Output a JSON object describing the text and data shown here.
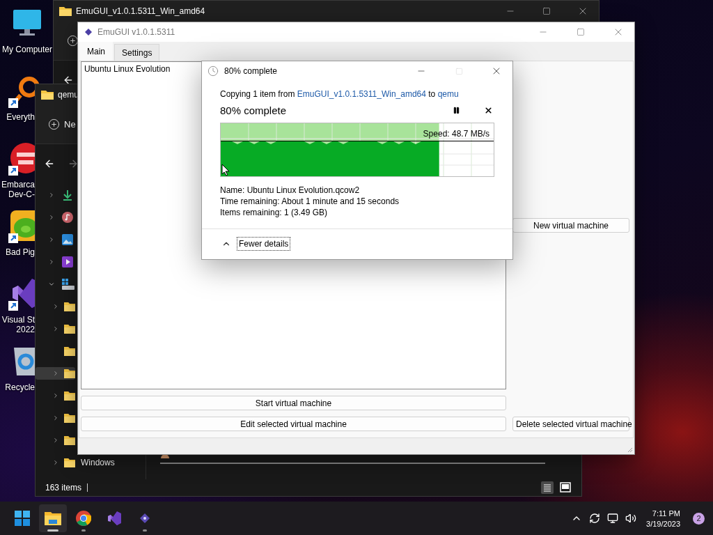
{
  "desktop_icons": [
    {
      "kind": "computer",
      "lines": [
        "My Computer"
      ],
      "shortcut": false
    },
    {
      "kind": "search",
      "lines": [
        "Everyth"
      ],
      "shortcut": true
    },
    {
      "kind": "red-ide",
      "lines": [
        "Embarca",
        "Dev-C-"
      ],
      "shortcut": true
    },
    {
      "kind": "game",
      "lines": [
        "Bad Pig"
      ],
      "shortcut": true
    },
    {
      "kind": "purple-ide",
      "lines": [
        "Visual St",
        "2022"
      ],
      "shortcut": true
    },
    {
      "kind": "bin",
      "lines": [
        "Recycle"
      ],
      "shortcut": false
    }
  ],
  "back_explorer": {
    "title": "EmuGUI_v1.0.1.5311_Win_amd64"
  },
  "qemu_explorer": {
    "title": "qemu",
    "new_label": "Ne",
    "status": "163 items",
    "tree": [
      {
        "kind": "downloads",
        "expandable": true,
        "expanded": false,
        "selected": false
      },
      {
        "kind": "music",
        "expandable": true,
        "expanded": false,
        "selected": false
      },
      {
        "kind": "pictures",
        "expandable": true,
        "expanded": false,
        "selected": false
      },
      {
        "kind": "videos",
        "expandable": true,
        "expanded": false,
        "selected": false
      },
      {
        "kind": "drive",
        "expandable": true,
        "expanded": true,
        "selected": false,
        "children": [
          {
            "kind": "folder",
            "expandable": true,
            "expanded": false,
            "selected": false
          },
          {
            "kind": "folder",
            "expandable": true,
            "expanded": false,
            "selected": false
          },
          {
            "kind": "folder",
            "expandable": false,
            "expanded": false,
            "selected": false
          },
          {
            "kind": "folder",
            "expandable": true,
            "expanded": false,
            "selected": true
          },
          {
            "kind": "folder",
            "expandable": true,
            "expanded": false,
            "selected": false
          },
          {
            "kind": "folder",
            "expandable": true,
            "expanded": false,
            "selected": false
          },
          {
            "kind": "folder",
            "expandable": true,
            "expanded": false,
            "selected": false
          },
          {
            "kind": "folder",
            "label": "Windows",
            "expandable": true,
            "expanded": false,
            "selected": false
          }
        ]
      }
    ]
  },
  "emugui": {
    "title": "EmuGUI v1.0.1.5311",
    "tabs": [
      {
        "label": "Main",
        "selected": true
      },
      {
        "label": "Settings",
        "selected": false
      }
    ],
    "vm_list": [
      {
        "name": "Ubuntu Linux Evolution",
        "selected": false
      }
    ],
    "buttons": {
      "new": "New virtual machine",
      "start": "Start virtual machine",
      "edit": "Edit selected virtual machine",
      "delete": "Delete selected virtual machine"
    }
  },
  "copy_dialog": {
    "title": "80% complete",
    "copy_line": {
      "prefix": "Copying 1 item from",
      "source": "EmuGUI_v1.0.1.5311_Win_amd64",
      "joiner": "to",
      "destination": "qemu"
    },
    "heading": "80% complete",
    "speed": "Speed: 48.7 MB/s",
    "level": 0.8,
    "details": [
      {
        "label": "Name:",
        "value": "Ubuntu Linux Evolution.qcow2"
      },
      {
        "label": "Time remaining:",
        "value": "About 1 minute and 15 seconds"
      },
      {
        "label": "Items remaining:",
        "value": "1 (3.49 GB)"
      }
    ],
    "details_toggle": {
      "label": "Fewer details",
      "expanded": true
    }
  },
  "taskbar": {
    "apps": [
      {
        "kind": "start",
        "running": false,
        "selected": false
      },
      {
        "kind": "explorer",
        "running": true,
        "selected": true
      },
      {
        "kind": "browser",
        "running": true,
        "selected": false
      },
      {
        "kind": "ide",
        "running": false,
        "selected": false
      },
      {
        "kind": "emugui",
        "running": true,
        "selected": false
      }
    ],
    "time": "7:11 PM",
    "date": "3/19/2023",
    "notifications": "2"
  }
}
